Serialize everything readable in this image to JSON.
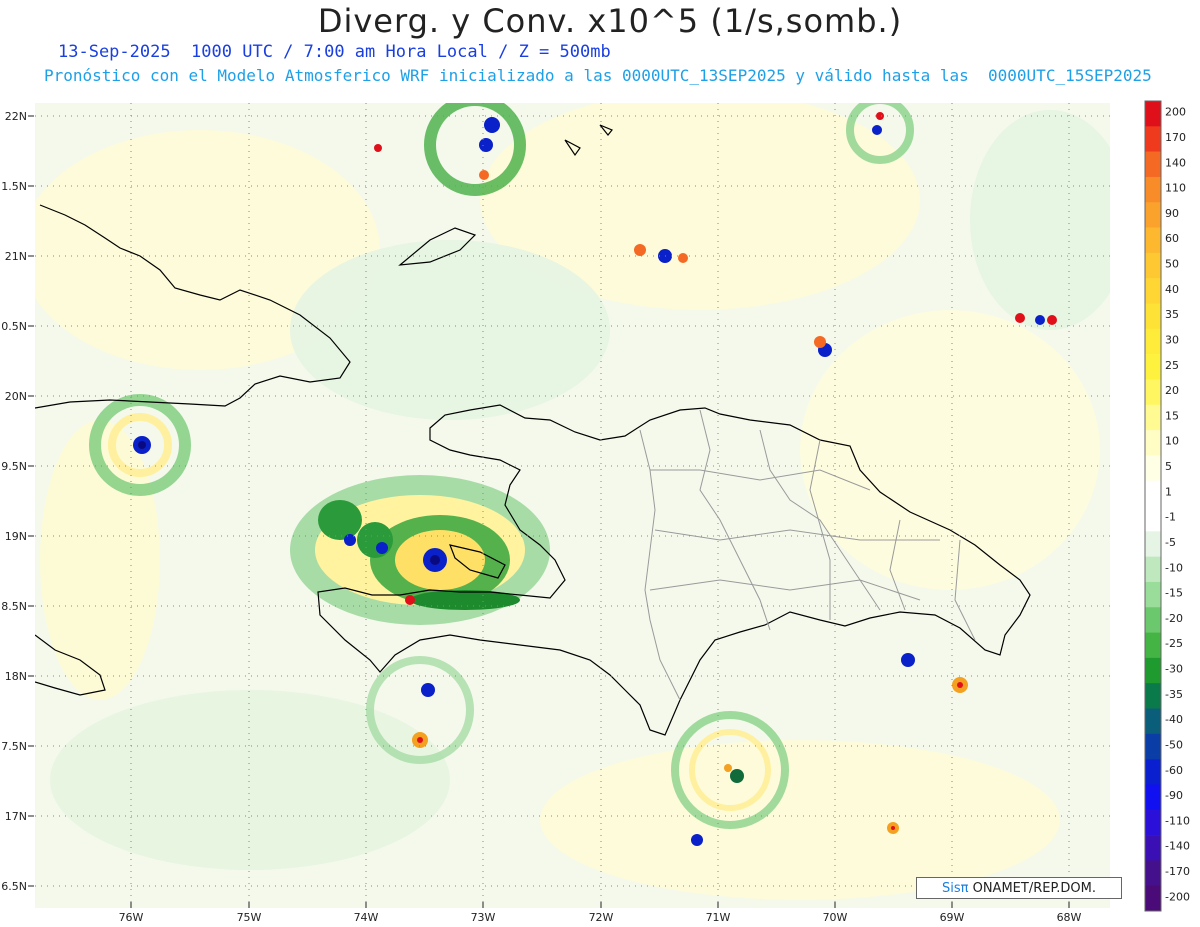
{
  "header": {
    "title": "Diverg. y Conv. x10^5 (1/s,somb.)",
    "valid_line": "13-Sep-2025  1000 UTC / 7:00 am Hora Local / Z = 500mb",
    "model_line": "Pronóstico con el Modelo Atmosferico WRF inicializado a las 0000UTC_13SEP2025 y válido hasta las  0000UTC_15SEP2025"
  },
  "map": {
    "lat_labels": [
      "22N",
      "1.5N",
      "21N",
      "0.5N",
      "20N",
      "9.5N",
      "19N",
      "8.5N",
      "18N",
      "7.5N",
      "17N",
      "6.5N"
    ],
    "lon_labels": [
      "76W",
      "75W",
      "74W",
      "73W",
      "72W",
      "71W",
      "70W",
      "69W",
      "68W"
    ],
    "background_color": "#ffffff",
    "coast_color": "#000000",
    "province_color": "#999999"
  },
  "colorbar": {
    "levels": [
      "200",
      "170",
      "140",
      "110",
      "90",
      "60",
      "50",
      "40",
      "35",
      "30",
      "25",
      "20",
      "15",
      "10",
      "5",
      "1",
      "-1",
      "-5",
      "-10",
      "-15",
      "-20",
      "-25",
      "-30",
      "-35",
      "-40",
      "-50",
      "-60",
      "-90",
      "-110",
      "-140",
      "-170",
      "-200"
    ],
    "colors": [
      "#e0101a",
      "#f03a1e",
      "#f46a24",
      "#f88c28",
      "#fba22c",
      "#fdb830",
      "#fec832",
      "#ffd634",
      "#ffe236",
      "#ffec3a",
      "#fff23e",
      "#fff662",
      "#fffa92",
      "#fffcc4",
      "#ffffe6",
      "#ffffff",
      "#ffffff",
      "#e6f4e6",
      "#bfe8bf",
      "#9adc9a",
      "#6cc86c",
      "#44b444",
      "#1e9a2e",
      "#0a7a4a",
      "#0a5e7a",
      "#0a3ea6",
      "#0a20d0",
      "#1010f0",
      "#2a10d8",
      "#3a10b4",
      "#44108c",
      "#4a0a78"
    ]
  },
  "credit": {
    "sis": "Sisπ",
    "text": " ONAMET/REP.DOM."
  }
}
